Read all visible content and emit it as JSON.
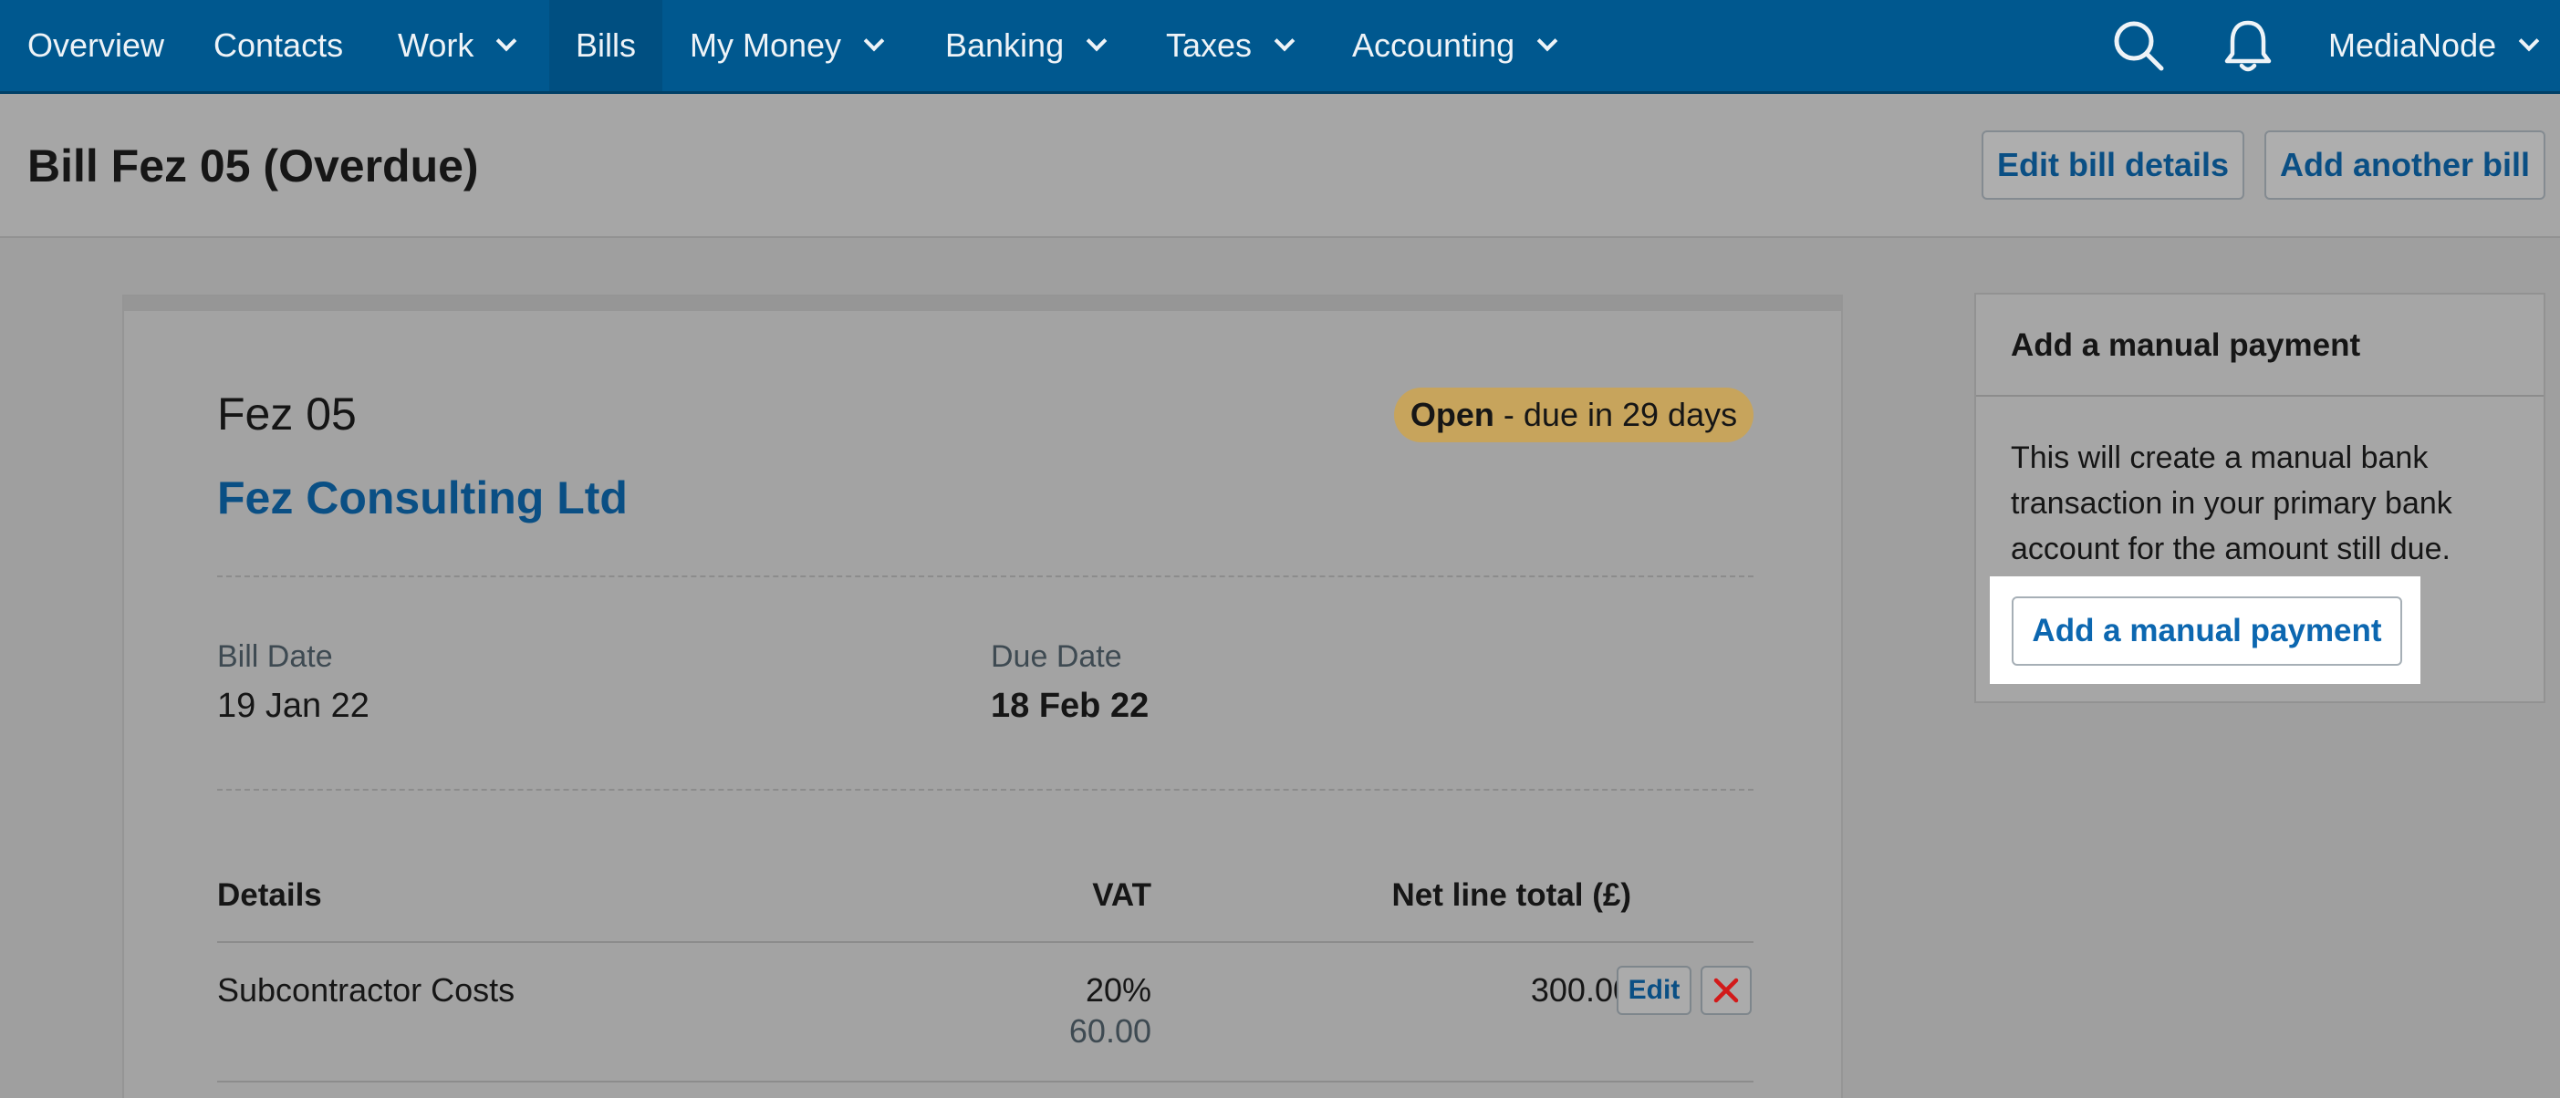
{
  "nav": {
    "items": [
      {
        "label": "Overview"
      },
      {
        "label": "Contacts"
      },
      {
        "label": "Work"
      },
      {
        "label": "Bills"
      },
      {
        "label": "My Money"
      },
      {
        "label": "Banking"
      },
      {
        "label": "Taxes"
      },
      {
        "label": "Accounting"
      }
    ],
    "active": "Bills",
    "icons": [
      "search-icon",
      "bell-icon"
    ],
    "user_menu_label": "MediaNode"
  },
  "page": {
    "title": "Bill Fez 05 (Overdue)",
    "actions": {
      "edit_label": "Edit bill details",
      "add_label": "Add another bill"
    }
  },
  "bill": {
    "reference": "Fez 05",
    "status": {
      "label": "Open",
      "detail": " - due in 29 days",
      "color": "#c7a45c"
    },
    "supplier": "Fez Consulting Ltd",
    "bill_date_label": "Bill Date",
    "bill_date": "19 Jan 22",
    "due_date_label": "Due Date",
    "due_date": "18 Feb 22",
    "table": {
      "headers": {
        "details": "Details",
        "vat": "VAT",
        "net": "Net line total (£)"
      },
      "rows": [
        {
          "details": "Subcontractor Costs",
          "vat_rate": "20%",
          "vat_amount": "60.00",
          "net": "300.00",
          "edit_label": "Edit"
        }
      ]
    }
  },
  "side_panel": {
    "title": "Add a manual payment",
    "text": "This will create a manual bank transaction in your primary bank account for the amount still due.",
    "button_label": "Add a manual payment"
  },
  "colors": {
    "nav_bg": "#00588f",
    "link": "#0a4f84",
    "delete": "#d21a1a"
  }
}
